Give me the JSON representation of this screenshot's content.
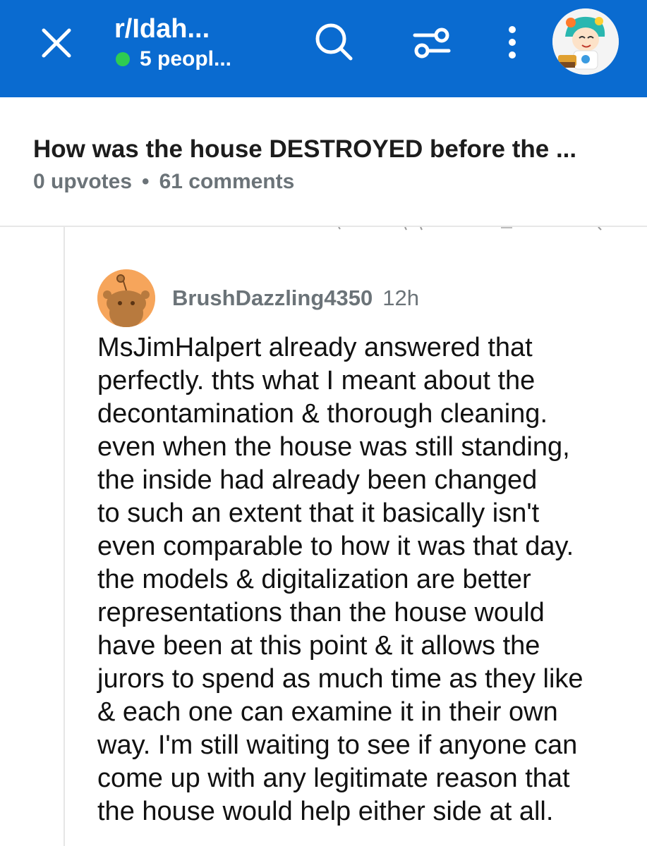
{
  "header": {
    "community": "r/Idah...",
    "online_text": "5 peopl...",
    "colors": {
      "bar": "#0a6bd0",
      "online_dot": "#2ecc52"
    },
    "icons": [
      "close-icon",
      "search-icon",
      "filter-icon",
      "more-vertical-icon",
      "user-avatar"
    ]
  },
  "post": {
    "title": "How was the house DESTROYED before the ...",
    "upvotes": "0 upvotes",
    "separator": "•",
    "comments": "61 comments"
  },
  "comment": {
    "username": "BrushDazzling4350",
    "time": "12h",
    "avatar_color": "#f6a55b",
    "lines": [
      "MsJimHalpert already answered that",
      "perfectly. thts what I meant about the",
      "decontamination & thorough cleaning.",
      "even when the house was still standing,",
      "the inside had already been changed",
      "to such an extent that it basically isn't",
      "even comparable to how it was that day.",
      "the models & digitalization are better",
      "representations than the house would",
      "have been at this point & it allows the",
      "jurors to spend as much time as they like",
      "& each one can examine it in their own",
      "way. I'm still waiting to see if anyone can",
      "come up with any legitimate reason that",
      "the house would help either side at all."
    ]
  }
}
